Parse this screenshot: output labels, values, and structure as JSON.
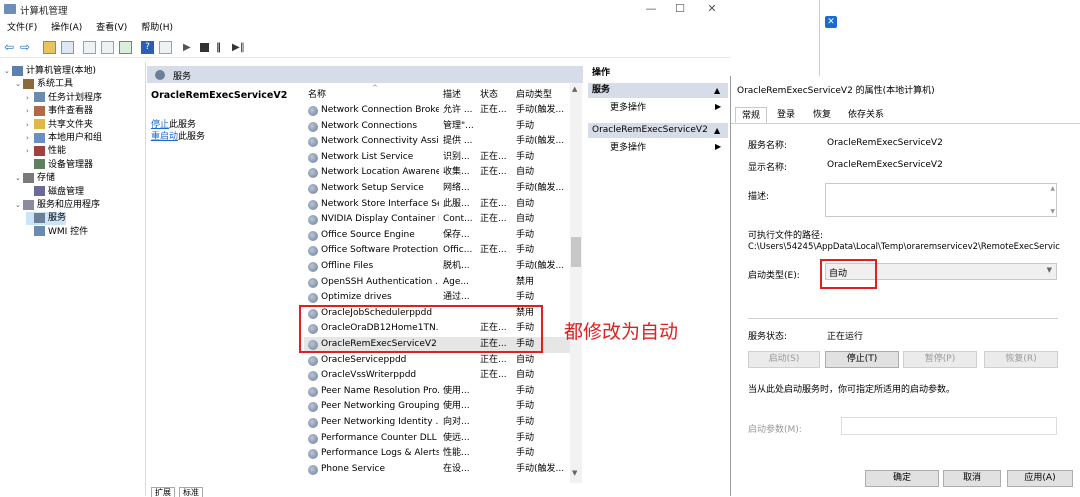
{
  "main": {
    "title": "计算机管理",
    "menu": [
      "文件(F)",
      "操作(A)",
      "查看(V)",
      "帮助(H)"
    ],
    "tree": [
      {
        "label": "计算机管理(本地)",
        "level": 0,
        "icon": "computer-icon"
      },
      {
        "label": "系统工具",
        "level": 1,
        "icon": "tools-icon"
      },
      {
        "label": "任务计划程序",
        "level": 2,
        "icon": "clock-icon"
      },
      {
        "label": "事件查看器",
        "level": 2,
        "icon": "log-icon"
      },
      {
        "label": "共享文件夹",
        "level": 2,
        "icon": "folder-icon"
      },
      {
        "label": "本地用户和组",
        "level": 2,
        "icon": "users-icon"
      },
      {
        "label": "性能",
        "level": 2,
        "icon": "perf-icon"
      },
      {
        "label": "设备管理器",
        "level": 2,
        "icon": "device-icon"
      },
      {
        "label": "存储",
        "level": 1,
        "icon": "storage-icon"
      },
      {
        "label": "磁盘管理",
        "level": 2,
        "icon": "disk-icon"
      },
      {
        "label": "服务和应用程序",
        "level": 1,
        "icon": "apps-icon"
      },
      {
        "label": "服务",
        "level": 2,
        "icon": "services-icon"
      },
      {
        "label": "WMI 控件",
        "level": 2,
        "icon": "wmi-icon"
      }
    ],
    "services_header": "服务",
    "selected_service": "OracleRemExecServiceV2",
    "stop_link": "停止",
    "stop_suffix": "此服务",
    "restart_link": "重启动",
    "restart_suffix": "此服务",
    "columns": [
      "名称",
      "描述",
      "状态",
      "启动类型"
    ],
    "rows": [
      [
        "Network Connection Broker",
        "允许 ...",
        "正在...",
        "手动(触发..."
      ],
      [
        "Network Connections",
        "管理\"...",
        "",
        "手动"
      ],
      [
        "Network Connectivity Assis...",
        "提供 ...",
        "",
        "手动(触发..."
      ],
      [
        "Network List Service",
        "识别...",
        "正在...",
        "手动"
      ],
      [
        "Network Location Awarene...",
        "收集...",
        "正在...",
        "自动"
      ],
      [
        "Network Setup Service",
        "网络...",
        "",
        "手动(触发..."
      ],
      [
        "Network Store Interface Se...",
        "此服...",
        "正在...",
        "自动"
      ],
      [
        "NVIDIA Display Container LS",
        "Cont...",
        "正在...",
        "自动"
      ],
      [
        "Office  Source Engine",
        "保存...",
        "",
        "手动"
      ],
      [
        "Office Software Protection ...",
        "Offic...",
        "正在...",
        "手动"
      ],
      [
        "Offline Files",
        "脱机...",
        "",
        "手动(触发..."
      ],
      [
        "OpenSSH Authentication ...",
        "Age...",
        "",
        "禁用"
      ],
      [
        "Optimize drives",
        "通过...",
        "",
        "手动"
      ],
      [
        "OracleJobSchedulerppdd",
        "",
        "",
        "禁用"
      ],
      [
        "OracleOraDB12Home1TN...",
        "",
        "正在...",
        "手动"
      ],
      [
        "OracleRemExecServiceV2",
        "",
        "正在...",
        "手动"
      ],
      [
        "OracleServiceppdd",
        "",
        "正在...",
        "自动"
      ],
      [
        "OracleVssWriterppdd",
        "",
        "正在...",
        "自动"
      ],
      [
        "Peer Name Resolution Pro...",
        "使用...",
        "",
        "手动"
      ],
      [
        "Peer Networking Grouping",
        "使用...",
        "",
        "手动"
      ],
      [
        "Peer Networking Identity ...",
        "向对...",
        "",
        "手动"
      ],
      [
        "Performance Counter DLL ...",
        "使远...",
        "",
        "手动"
      ],
      [
        "Performance Logs & Alerts",
        "性能...",
        "",
        "手动"
      ],
      [
        "Phone Service",
        "在设...",
        "",
        "手动(触发..."
      ]
    ],
    "bottom_tabs": [
      "扩展",
      "标准"
    ],
    "actions_title": "操作",
    "actions": [
      {
        "header": "服务",
        "item": "更多操作"
      },
      {
        "header": "OracleRemExecServiceV2",
        "item": "更多操作"
      }
    ]
  },
  "annotation": "都修改为自动",
  "dialog": {
    "title": "OracleRemExecServiceV2 的属性(本地计算机)",
    "tabs": [
      "常规",
      "登录",
      "恢复",
      "依存关系"
    ],
    "service_name_label": "服务名称:",
    "service_name": "OracleRemExecServiceV2",
    "display_name_label": "显示名称:",
    "display_name": "OracleRemExecServiceV2",
    "description_label": "描述:",
    "path_label": "可执行文件的路径:",
    "path": "C:\\Users\\54245\\AppData\\Local\\Temp\\oraremservicev2\\RemoteExecServic",
    "startup_label": "启动类型(E):",
    "startup_value": "自动",
    "status_label": "服务状态:",
    "status_value": "正在运行",
    "buttons": [
      "启动(S)",
      "停止(T)",
      "暂停(P)",
      "恢复(R)"
    ],
    "hint": "当从此处启动服务时，你可指定所适用的启动参数。",
    "params_label": "启动参数(M):",
    "ok": "确定",
    "cancel": "取消",
    "apply": "应用(A)"
  },
  "colors": {
    "accent": "#1a6bd0",
    "highlight_red": "#e02020",
    "header_bg": "#d6dde8"
  }
}
